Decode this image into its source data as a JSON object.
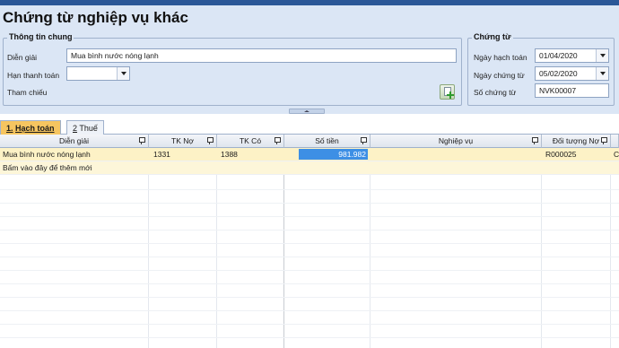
{
  "title": "Chứng từ nghiệp vụ khác",
  "general_info": {
    "title": "Thông tin chung",
    "description_label": "Diễn giải",
    "description_value": "Mua bình nước nóng lạnh",
    "payment_term_label": "Hạn thanh toán",
    "payment_term_value": "",
    "reference_label": "Tham chiếu"
  },
  "voucher": {
    "title": "Chứng từ",
    "posting_date_label": "Ngày hạch toán",
    "posting_date_value": "01/04/2020",
    "voucher_date_label": "Ngày chứng từ",
    "voucher_date_value": "05/02/2020",
    "voucher_no_label": "Số chứng từ",
    "voucher_no_value": "NVK00007"
  },
  "tabs": [
    {
      "key": "1.",
      "label": "Hạch toán"
    },
    {
      "key": "2",
      "label": "Thuế"
    }
  ],
  "grid": {
    "columns": [
      "Diễn giải",
      "TK Nợ",
      "TK Có",
      "Số tiền",
      "Nghiệp vụ",
      "Đối tượng Nợ"
    ],
    "rows": [
      {
        "description": "Mua bình nước nóng lạnh",
        "debit": "1331",
        "credit": "1388",
        "amount": "981.982",
        "operation": "",
        "debtor": "R000025",
        "extra": "C"
      }
    ],
    "new_row_hint": "Bấm vào đây để thêm mới"
  },
  "colors": {
    "panel_bg": "#dbe6f5",
    "active_tab": "#f6c560",
    "selected_cell": "#3d8fe5",
    "row_highlight": "#fdf2c6"
  }
}
